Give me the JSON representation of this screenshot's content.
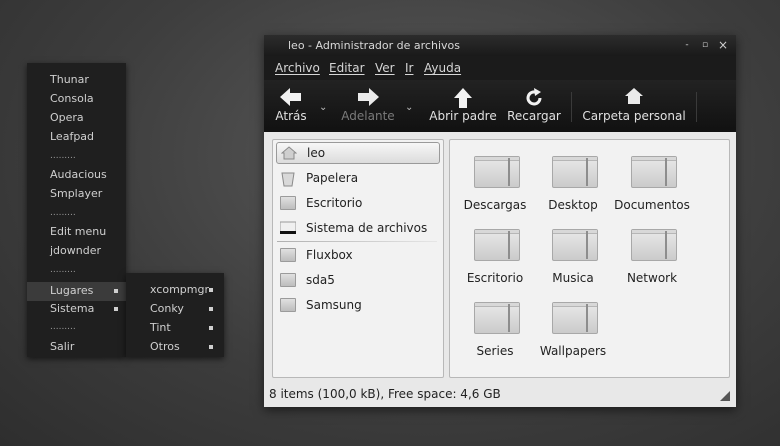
{
  "root_menu": {
    "items": [
      {
        "label": "Thunar"
      },
      {
        "label": "Consola"
      },
      {
        "label": "Opera"
      },
      {
        "label": "Leafpad"
      },
      {
        "separator": "........."
      },
      {
        "label": "Audacious"
      },
      {
        "label": "Smplayer"
      },
      {
        "separator": "........."
      },
      {
        "label": "Edit menu"
      },
      {
        "label": "jdownder"
      },
      {
        "separator": "........."
      },
      {
        "label": "Lugares",
        "submenu": true,
        "highlighted": true
      },
      {
        "label": "Sistema",
        "submenu": true
      },
      {
        "separator": "........."
      },
      {
        "label": "Salir"
      }
    ]
  },
  "sub_menu": {
    "items": [
      {
        "label": "xcompmgr"
      },
      {
        "label": "Conky"
      },
      {
        "label": "Tint"
      },
      {
        "label": "Otros"
      }
    ]
  },
  "window": {
    "title": "leo - Administrador de archivos",
    "controls": {
      "minimize": "-",
      "maximize": "▫",
      "close": "×"
    },
    "menubar": [
      "Archivo",
      "Editar",
      "Ver",
      "Ir",
      "Ayuda"
    ],
    "toolbar": {
      "back": "Atrás",
      "forward": "Adelante",
      "up": "Abrir padre",
      "reload": "Recargar",
      "home": "Carpeta personal"
    },
    "places": [
      {
        "label": "leo",
        "icon": "home-icon",
        "selected": true
      },
      {
        "label": "Papelera",
        "icon": "trash-icon"
      },
      {
        "label": "Escritorio",
        "icon": "folder-icon"
      },
      {
        "label": "Sistema de archivos",
        "icon": "drive-icon"
      },
      {
        "label": "Fluxbox",
        "icon": "folder-icon"
      },
      {
        "label": "sda5",
        "icon": "drive-icon"
      },
      {
        "label": "Samsung",
        "icon": "drive-icon"
      }
    ],
    "files": [
      {
        "name": "Descargas"
      },
      {
        "name": "Desktop"
      },
      {
        "name": "Documentos"
      },
      {
        "name": "Escritorio"
      },
      {
        "name": "Musica"
      },
      {
        "name": "Network"
      },
      {
        "name": "Series"
      },
      {
        "name": "Wallpapers"
      }
    ],
    "status": "8 items (100,0 kB), Free space: 4,6 GB"
  }
}
